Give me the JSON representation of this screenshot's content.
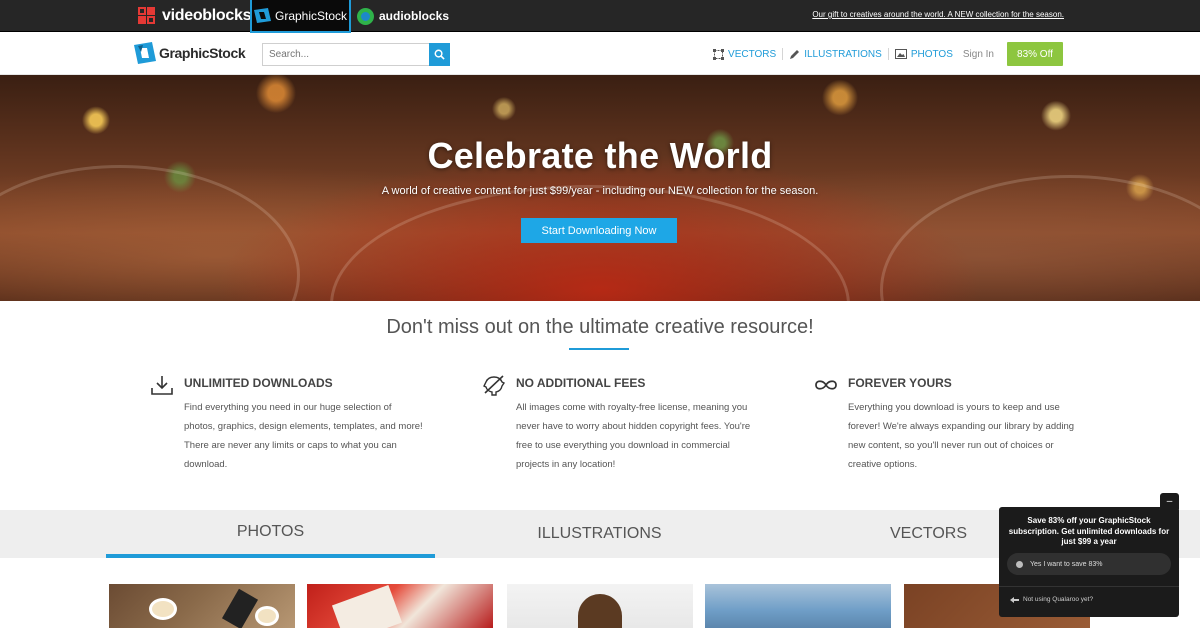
{
  "network_bar": {
    "videoblocks": "videoblocks",
    "graphicstock": "GraphicStock",
    "audioblocks": "audioblocks",
    "promo_link": "Our gift to creatives around the world. A NEW collection for the season."
  },
  "nav": {
    "logo_text": "GraphicStock",
    "search_placeholder": "Search...",
    "links": {
      "vectors": "VECTORS",
      "illustrations": "ILLUSTRATIONS",
      "photos": "PHOTOS"
    },
    "sign_in": "Sign In",
    "offer_button": "83% Off"
  },
  "hero": {
    "title": "Celebrate the World",
    "subtitle": "A world of creative content for just $99/year - including our NEW collection for the season.",
    "cta": "Start Downloading Now"
  },
  "section_title": "Don't miss out on the ultimate creative resource!",
  "features": [
    {
      "title": "UNLIMITED DOWNLOADS",
      "body": "Find everything you need in our huge selection of photos, graphics, design elements, templates, and more! There are never any limits or caps to what you can download.",
      "icon": "download-icon"
    },
    {
      "title": "NO ADDITIONAL FEES",
      "body": "All images come with royalty-free license, meaning you never have to worry about hidden copyright fees. You're free to use everything you download in commercial projects in any location!",
      "icon": "no-fees-icon"
    },
    {
      "title": "FOREVER YOURS",
      "body": "Everything you download is yours to keep and use forever! We're always expanding our library by adding new content, so you'll never run out of choices or creative options.",
      "icon": "infinity-icon"
    }
  ],
  "tabs": [
    {
      "label": "PHOTOS",
      "active": true
    },
    {
      "label": "ILLUSTRATIONS",
      "active": false
    },
    {
      "label": "VECTORS",
      "active": false
    }
  ],
  "survey": {
    "close": "–",
    "question": "Save 83% off your GraphicStock subscription. Get unlimited downloads for just $99 a year",
    "option": "Yes I want to save 83%",
    "footer": "Not using Qualaroo yet?"
  },
  "colors": {
    "accent": "#1f9bd8",
    "offer_green": "#8dc63f",
    "topbar": "#262626"
  }
}
